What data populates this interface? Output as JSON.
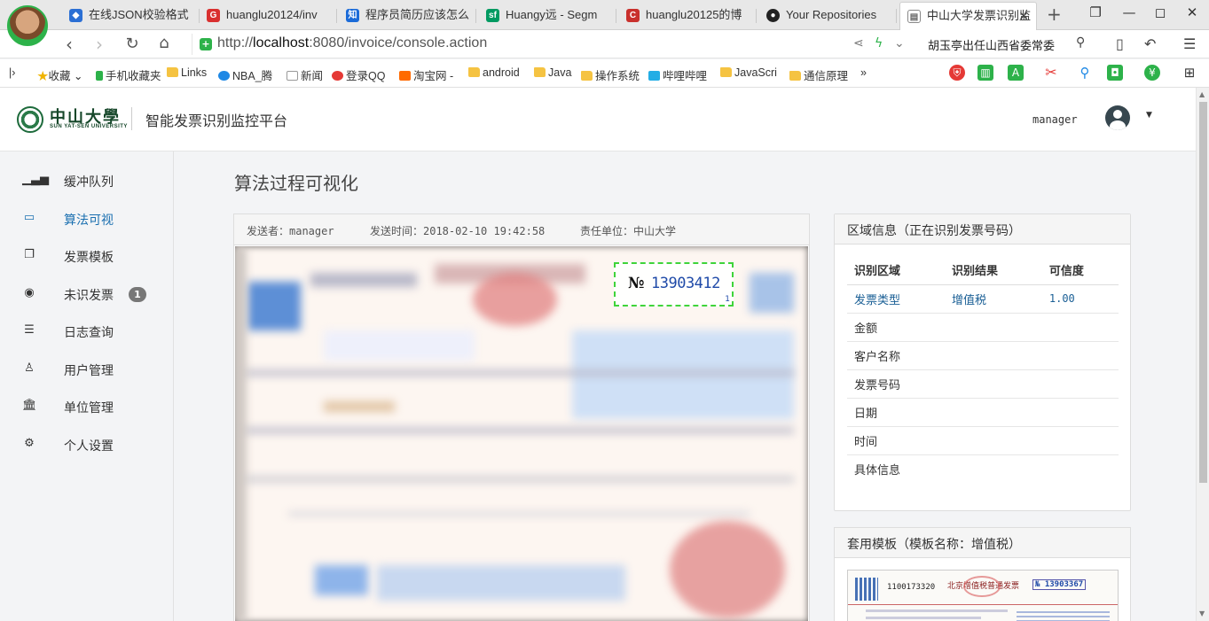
{
  "browser": {
    "tabs": [
      {
        "title": "在线JSON校验格式",
        "icon": "diamond-icon",
        "color": "#2b6fd4"
      },
      {
        "title": "huanglu20124/inv",
        "icon": "G",
        "color": "#d9302f"
      },
      {
        "title": "程序员简历应该怎么",
        "icon": "知",
        "color": "#1b6bd8"
      },
      {
        "title": "Huangy远 - Segm",
        "icon": "sf",
        "color": "#009a61"
      },
      {
        "title": "huanglu20125的博",
        "icon": "C",
        "color": "#c9302c"
      },
      {
        "title": "Your Repositories",
        "icon": "github-icon",
        "color": "#222222"
      },
      {
        "title": "中山大学发票识别监",
        "icon": "page-icon",
        "color": "#666666"
      }
    ],
    "url_prefix": "http://",
    "url_host": "localhost",
    "url_rest": ":8080/invoice/console.action",
    "search_hint": "胡玉亭出任山西省委常委",
    "bookmarks": [
      {
        "label": "收藏"
      },
      {
        "label": "手机收藏夹"
      },
      {
        "label": "Links"
      },
      {
        "label": "NBA_腾"
      },
      {
        "label": "新闻"
      },
      {
        "label": "登录QQ"
      },
      {
        "label": "淘宝网 -"
      },
      {
        "label": "android"
      },
      {
        "label": "Java"
      },
      {
        "label": "操作系统"
      },
      {
        "label": "哔哩哔哩"
      },
      {
        "label": "JavaScri"
      },
      {
        "label": "通信原理"
      },
      {
        "label": "»"
      }
    ]
  },
  "header": {
    "logo_text": "中山大學",
    "logo_sub": "SUN YAT-SEN UNIVERSITY",
    "title": "智能发票识别监控平台",
    "username": "manager"
  },
  "sidebar": {
    "items": [
      {
        "label": "缓冲队列",
        "icon": "bar-chart-icon"
      },
      {
        "label": "算法可视",
        "icon": "monitor-icon"
      },
      {
        "label": "发票模板",
        "icon": "copy-icon"
      },
      {
        "label": "未识发票",
        "icon": "record-icon",
        "badge": "1"
      },
      {
        "label": "日志查询",
        "icon": "list-icon"
      },
      {
        "label": "用户管理",
        "icon": "user-icon"
      },
      {
        "label": "单位管理",
        "icon": "bank-icon"
      },
      {
        "label": "个人设置",
        "icon": "gear-icon"
      }
    ]
  },
  "main": {
    "heading": "算法过程可视化",
    "meta": {
      "sender": "发送者：manager",
      "time": "发送时间：2018-02-10 19:42:58",
      "unit": "责任单位：中山大学"
    },
    "detection": {
      "symbol": "№",
      "number": "13903412",
      "index": "1"
    }
  },
  "region_panel": {
    "title": "区域信息（正在识别发票号码）",
    "columns": [
      "识别区域",
      "识别结果",
      "可信度"
    ],
    "rows": [
      [
        "发票类型",
        "增值税",
        "1.00"
      ],
      [
        "金额",
        "",
        ""
      ],
      [
        "客户名称",
        "",
        ""
      ],
      [
        "发票号码",
        "",
        ""
      ],
      [
        "日期",
        "",
        ""
      ],
      [
        "时间",
        "",
        ""
      ],
      [
        "具体信息",
        "",
        ""
      ]
    ]
  },
  "template_panel": {
    "title": "套用模板（模板名称：增值税）",
    "thumb_code": "1100173320",
    "thumb_title": "北京增值税普通发票",
    "thumb_no": "№ 13903367"
  },
  "colors": {
    "accent": "#1a6fb0",
    "detect_box": "#3fd43a",
    "badge": "#777777"
  }
}
